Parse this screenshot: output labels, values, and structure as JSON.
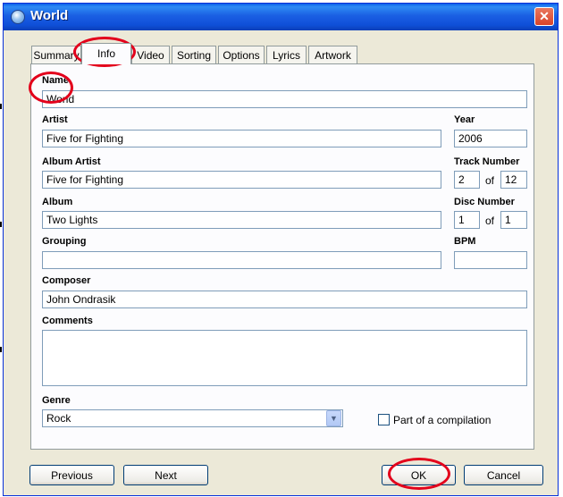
{
  "window": {
    "title": "World",
    "close_label": "✕"
  },
  "tabs": [
    "Summary",
    "Info",
    "Video",
    "Sorting",
    "Options",
    "Lyrics",
    "Artwork"
  ],
  "active_tab": "Info",
  "fields": {
    "name": {
      "label": "Name",
      "value": "World"
    },
    "artist": {
      "label": "Artist",
      "value": "Five for Fighting"
    },
    "year": {
      "label": "Year",
      "value": "2006"
    },
    "album_artist": {
      "label": "Album Artist",
      "value": "Five for Fighting"
    },
    "track_number": {
      "label": "Track Number",
      "value": "2",
      "of_label": "of",
      "total": "12"
    },
    "album": {
      "label": "Album",
      "value": "Two Lights"
    },
    "disc_number": {
      "label": "Disc Number",
      "value": "1",
      "of_label": "of",
      "total": "1"
    },
    "grouping": {
      "label": "Grouping",
      "value": ""
    },
    "bpm": {
      "label": "BPM",
      "value": ""
    },
    "composer": {
      "label": "Composer",
      "value": "John Ondrasik"
    },
    "comments": {
      "label": "Comments",
      "value": ""
    },
    "genre": {
      "label": "Genre",
      "value": "Rock"
    }
  },
  "compilation": {
    "label": "Part of a compilation",
    "checked": false
  },
  "buttons": {
    "previous": "Previous",
    "next": "Next",
    "ok": "OK",
    "cancel": "Cancel"
  },
  "colors": {
    "titlebar": "#0a5ee9",
    "dialog_bg": "#ece9d8",
    "highlight_ring": "#e3001b",
    "field_border": "#7f9db9"
  }
}
